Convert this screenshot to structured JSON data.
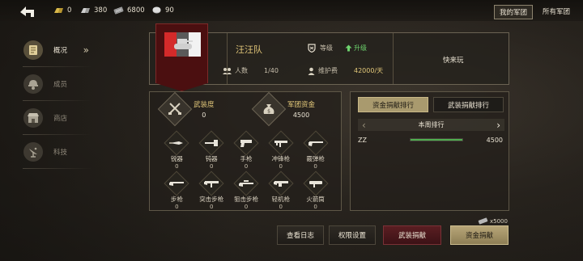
{
  "top_bar": {
    "resources": [
      {
        "icon": "gold-bars-icon",
        "value": "0"
      },
      {
        "icon": "silver-bars-icon",
        "value": "380"
      },
      {
        "icon": "cash-stack-icon",
        "value": "6800"
      },
      {
        "icon": "token-coin-icon",
        "value": "90"
      }
    ],
    "tabs": [
      {
        "label": "我的军团",
        "active": true
      },
      {
        "label": "所有军团",
        "active": false
      }
    ]
  },
  "nav": {
    "items": [
      {
        "label": "概况",
        "icon": "scroll-icon",
        "active": true
      },
      {
        "label": "成员",
        "icon": "soldier-helmet-icon",
        "active": false
      },
      {
        "label": "商店",
        "icon": "shop-icon",
        "active": false
      },
      {
        "label": "科技",
        "icon": "radar-dish-icon",
        "active": false
      }
    ]
  },
  "legion": {
    "name": "汪汪队",
    "members_label": "人数",
    "members_value": "1/40",
    "level_label": "等级",
    "upgrade_label": "升级",
    "fee_label": "维护费",
    "fee_value": "42000/天",
    "announcement": "快来玩",
    "flag_colors": [
      "#d42a2a",
      "#4a4a4a",
      "#f2f2f2"
    ]
  },
  "donations": {
    "armament_label": "武装度",
    "armament_value": "0",
    "funds_label": "军团资金",
    "funds_value": "4500",
    "weapons": [
      {
        "name": "锐器",
        "value": "0",
        "icon": "knife-icon"
      },
      {
        "name": "钝器",
        "value": "0",
        "icon": "hammer-icon"
      },
      {
        "name": "手枪",
        "value": "0",
        "icon": "pistol-icon"
      },
      {
        "name": "冲锋枪",
        "value": "0",
        "icon": "smg-icon"
      },
      {
        "name": "霰弹枪",
        "value": "0",
        "icon": "shotgun-icon"
      },
      {
        "name": "步枪",
        "value": "0",
        "icon": "rifle-icon"
      },
      {
        "name": "突击步枪",
        "value": "0",
        "icon": "assault-rifle-icon"
      },
      {
        "name": "狙击步枪",
        "value": "0",
        "icon": "sniper-rifle-icon"
      },
      {
        "name": "轻机枪",
        "value": "0",
        "icon": "machine-gun-icon"
      },
      {
        "name": "火箭筒",
        "value": "0",
        "icon": "rocket-launcher-icon"
      }
    ]
  },
  "ranking": {
    "tabs": [
      {
        "label": "资金捐献排行",
        "active": true
      },
      {
        "label": "武装捐献排行",
        "active": false
      }
    ],
    "period_label": "本周排行",
    "rows": [
      {
        "name": "ZZ",
        "value": "4500",
        "progress": 1.0
      }
    ]
  },
  "footer": {
    "cost_value": "x5000",
    "cost_icon": "cash-stack-icon",
    "buttons": {
      "log": "查看日志",
      "permissions": "权限设置",
      "armament_donate": "武装捐献",
      "fund_donate": "资金捐献"
    }
  }
}
